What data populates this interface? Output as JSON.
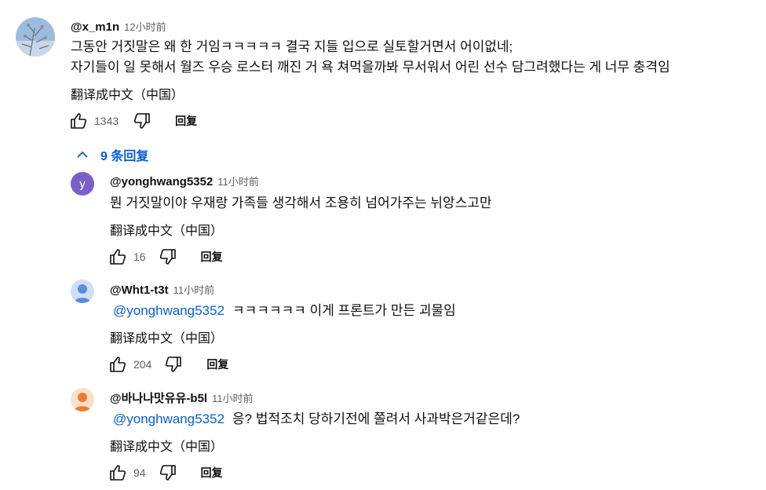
{
  "comment": {
    "author": "@x_m1n",
    "time": "12小时前",
    "lines": [
      "그동안 거짓말은 왜 한 거임ㅋㅋㅋㅋㅋ 결국 지들 입으로 실토할거면서 어이없네;",
      "자기들이 일 못해서 월즈 우승 로스터 깨진 거 욕 쳐먹을까봐 무서워서 어린 선수 담그려했다는 게 너무 충격임"
    ],
    "translate": "翻译成中文（中国）",
    "likes": "1343",
    "reply_label": "回复"
  },
  "replies_toggle": {
    "label": "9 条回复"
  },
  "replies": [
    {
      "author": "@yonghwang5352",
      "time": "11小时前",
      "avatar_letter": "y",
      "mention": "",
      "text": "뭔 거짓말이야 우재랑 가족들 생각해서 조용히 넘어가주는 뉘앙스고만",
      "translate": "翻译成中文（中国）",
      "likes": "16",
      "reply_label": "回复"
    },
    {
      "author": "@Wht1-t3t",
      "time": "11小时前",
      "mention": "@yonghwang5352",
      "text": "ㅋㅋㅋㅋㅋㅋ 이게 프론트가 만든 괴물임",
      "translate": "翻译成中文（中国）",
      "likes": "204",
      "reply_label": "回复"
    },
    {
      "author": "@바나나맛유유-b5l",
      "time": "11小时前",
      "mention": "@yonghwang5352",
      "text": "응? 법적조치 당하기전에 쫄려서 사과박은거같은데?",
      "translate": "翻译成中文（中国）",
      "likes": "94",
      "reply_label": "回复"
    }
  ],
  "colors": {
    "link": "#065fd4",
    "avatar_purple": "#7b5fc9",
    "avatar_blue": "#5a8ddb",
    "avatar_orange": "#ee7a2e",
    "muted": "#606060"
  }
}
